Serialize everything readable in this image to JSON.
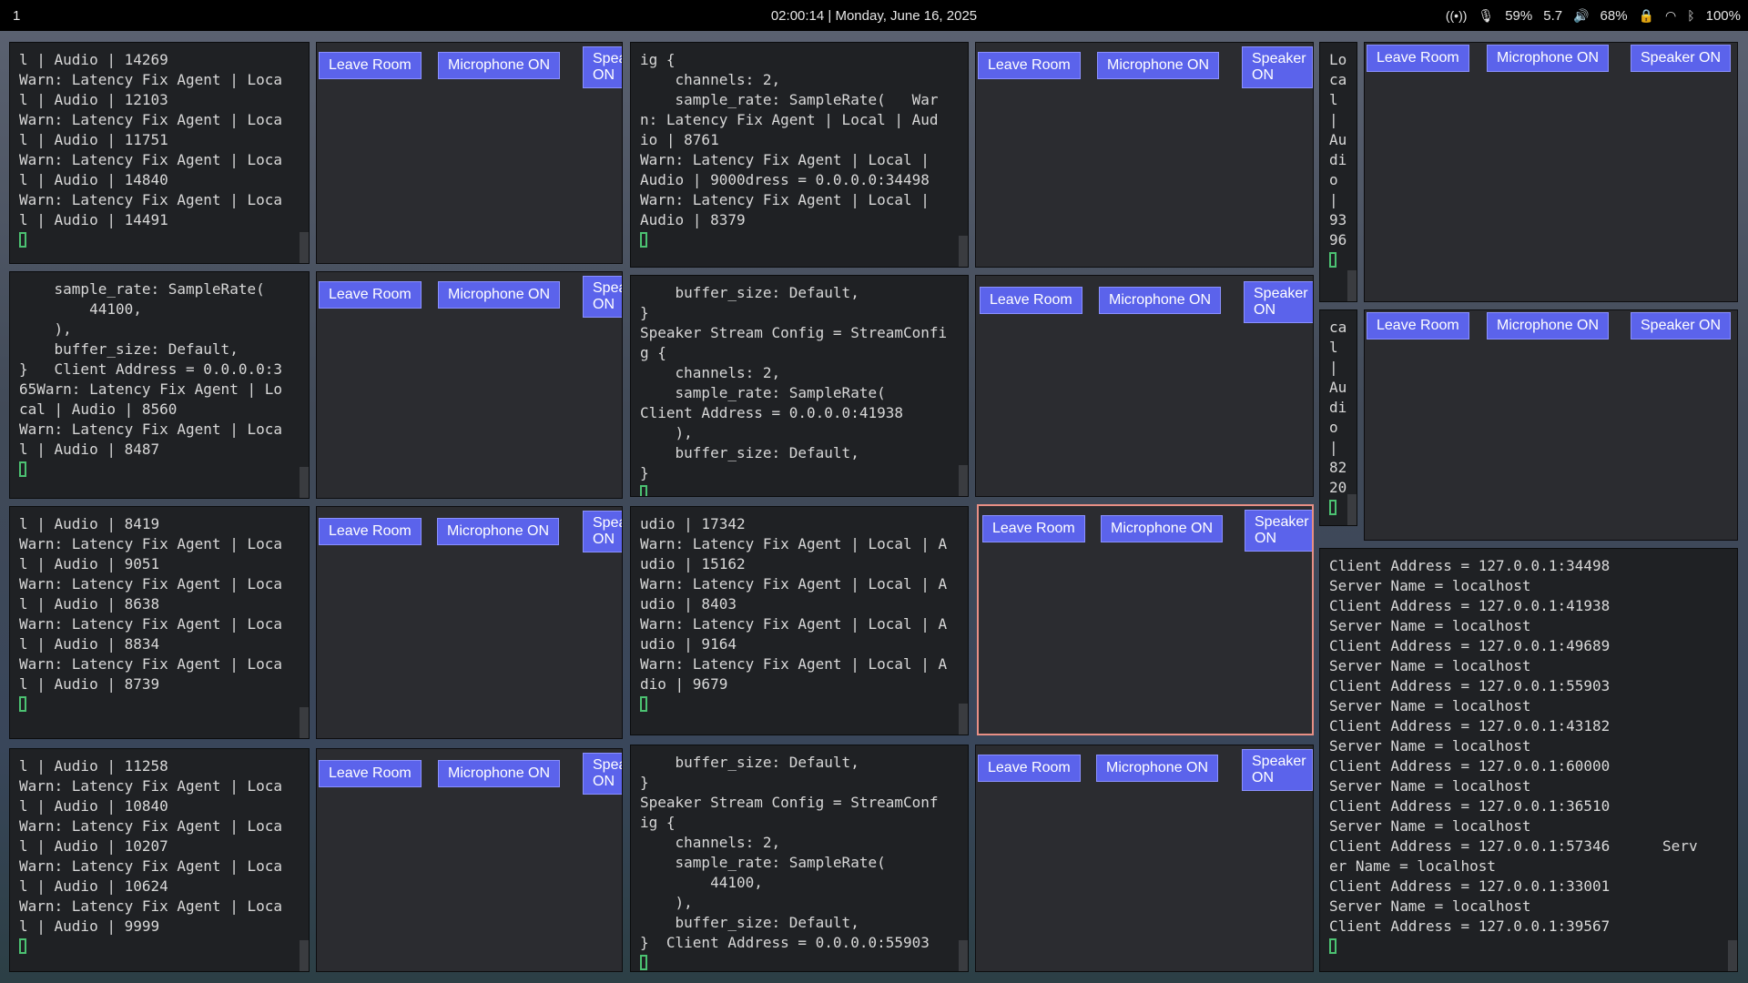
{
  "topbar": {
    "workspace": "1",
    "clock": "02:00:14 | Monday, June 16, 2025",
    "cpu": "59%",
    "load": "5.7",
    "volume": "68%",
    "battery": "100%"
  },
  "room_buttons": {
    "leave": "Leave Room",
    "mic": "Microphone ON",
    "speaker": "Speaker ON",
    "speaker_cut": "Spea ON"
  },
  "terminals": {
    "t1": [
      "l | Audio | 14269",
      "Warn: Latency Fix Agent | Loca",
      "l | Audio | 12103",
      "Warn: Latency Fix Agent | Loca",
      "l | Audio | 11751",
      "Warn: Latency Fix Agent | Loca",
      "l | Audio | 14840",
      "Warn: Latency Fix Agent | Loca",
      "l | Audio | 14491"
    ],
    "t2": [
      "ig {",
      "    channels: 2,",
      "    sample_rate: SampleRate(   War",
      "n: Latency Fix Agent | Local | Aud",
      "io | 8761",
      "Warn: Latency Fix Agent | Local |",
      "Audio | 9000dress = 0.0.0.0:34498",
      "Warn: Latency Fix Agent | Local |",
      "Audio | 8379"
    ],
    "t3": [
      "Lo",
      "ca",
      "l",
      "|",
      "Au",
      "di",
      "o",
      "|",
      "93",
      "96"
    ],
    "t4": [
      "    sample_rate: SampleRate(",
      "        44100,",
      "    ),",
      "    buffer_size: Default,",
      "}   Client Address = 0.0.0.0:3",
      "65Warn: Latency Fix Agent | Lo",
      "cal | Audio | 8560",
      "Warn: Latency Fix Agent | Loca",
      "l | Audio | 8487"
    ],
    "t5": [
      "    buffer_size: Default,",
      "}",
      "Speaker Stream Config = StreamConfi",
      "g {",
      "    channels: 2,",
      "    sample_rate: SampleRate(",
      "Client Address = 0.0.0.0:41938",
      "    ),",
      "    buffer_size: Default,",
      "}"
    ],
    "t6": [
      "ca",
      "l",
      "|",
      "Au",
      "di",
      "o",
      "|",
      "82",
      "20"
    ],
    "t7": [
      "l | Audio | 8419",
      "Warn: Latency Fix Agent | Loca",
      "l | Audio | 9051",
      "Warn: Latency Fix Agent | Loca",
      "l | Audio | 8638",
      "Warn: Latency Fix Agent | Loca",
      "l | Audio | 8834",
      "Warn: Latency Fix Agent | Loca",
      "l | Audio | 8739"
    ],
    "t8": [
      "udio | 17342",
      "Warn: Latency Fix Agent | Local | A",
      "udio | 15162",
      "Warn: Latency Fix Agent | Local | A",
      "udio | 8403",
      "Warn: Latency Fix Agent | Local | A",
      "udio | 9164",
      "Warn: Latency Fix Agent | Local | A",
      "dio | 9679"
    ],
    "t9": [
      "Client Address = 127.0.0.1:34498",
      "Server Name = localhost",
      "Client Address = 127.0.0.1:41938",
      "Server Name = localhost",
      "Client Address = 127.0.0.1:49689",
      "Server Name = localhost",
      "Client Address = 127.0.0.1:55903",
      "Server Name = localhost",
      "Client Address = 127.0.0.1:43182",
      "Server Name = localhost",
      "Client Address = 127.0.0.1:60000",
      "Server Name = localhost",
      "Client Address = 127.0.0.1:36510",
      "Server Name = localhost",
      "Client Address = 127.0.0.1:57346      Serv",
      "er Name = localhost",
      "Client Address = 127.0.0.1:33001",
      "Server Name = localhost",
      "Client Address = 127.0.0.1:39567"
    ],
    "t10": [
      "l | Audio | 11258",
      "Warn: Latency Fix Agent | Loca",
      "l | Audio | 10840",
      "Warn: Latency Fix Agent | Loca",
      "l | Audio | 10207",
      "Warn: Latency Fix Agent | Loca",
      "l | Audio | 10624",
      "Warn: Latency Fix Agent | Loca",
      "l | Audio | 9999"
    ],
    "t11": [
      "    buffer_size: Default,",
      "}",
      "Speaker Stream Config = StreamConf",
      "ig {",
      "    channels: 2,",
      "    sample_rate: SampleRate(",
      "        44100,",
      "    ),",
      "    buffer_size: Default,",
      "}  Client Address = 0.0.0.0:55903"
    ]
  }
}
